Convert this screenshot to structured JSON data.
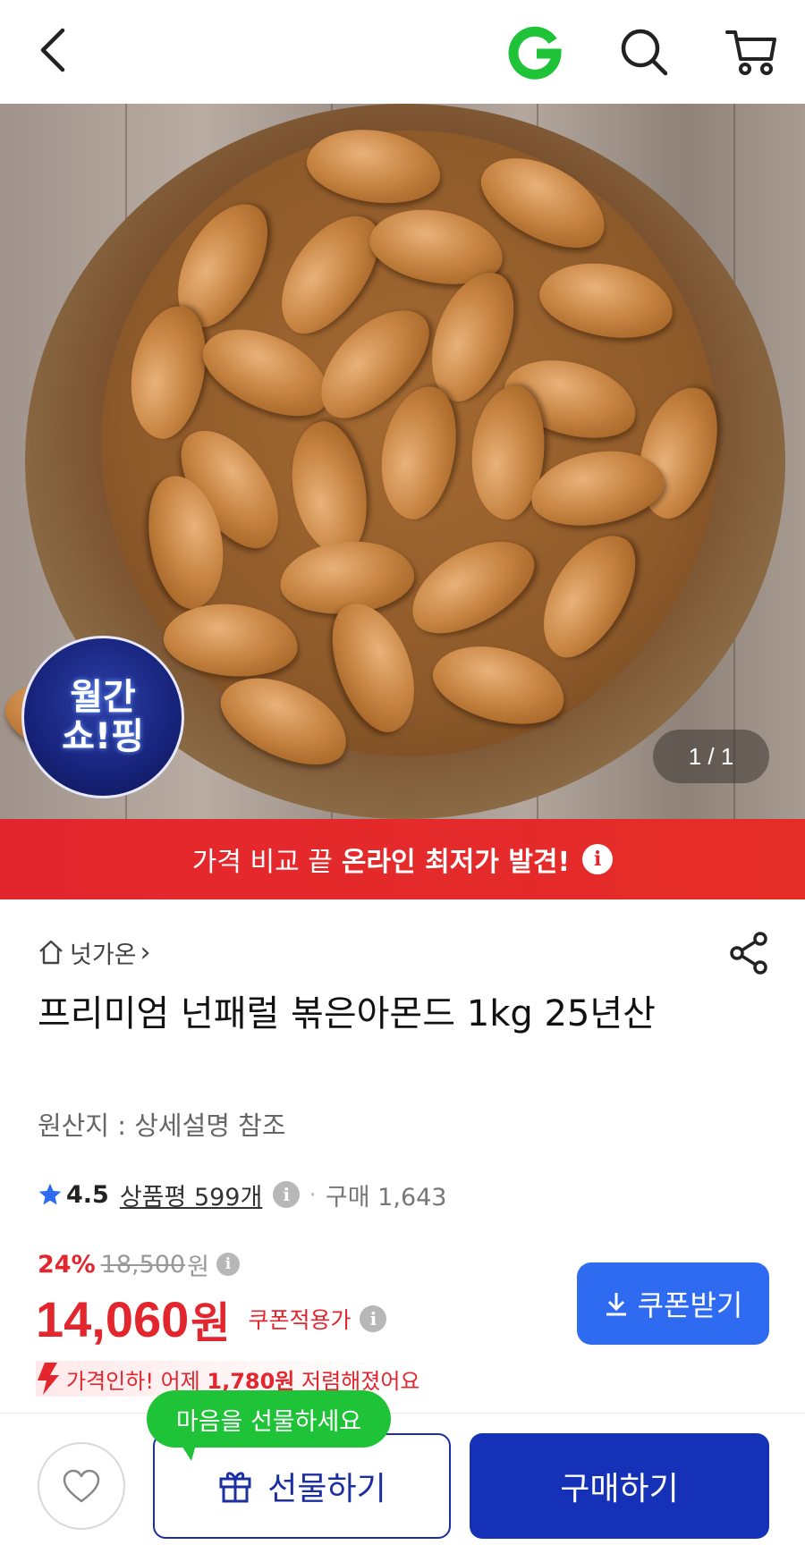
{
  "header": {
    "back_icon": "chevron-left-icon",
    "logo_icon": "gmarket-g-logo",
    "search_icon": "search-icon",
    "cart_icon": "cart-icon",
    "logo_color": "#1ec337"
  },
  "hero": {
    "badge_line1": "월간",
    "badge_line2": "쇼!핑",
    "counter": "1 / 1"
  },
  "banner": {
    "prefix": "가격 비교 끝",
    "highlight": "온라인 최저가 발견!",
    "info": "i",
    "color": "#e3262e"
  },
  "product": {
    "store": "넛가온",
    "store_chevron": "›",
    "title": "프리미엄 넌패럴 볶은아몬드 1kg 25년산",
    "origin": "원산지 : 상세설명 참조",
    "rating": "4.5",
    "reviews": "상품평 599개",
    "sold_sep": "·",
    "sold": "구매 1,643"
  },
  "price": {
    "discount": "24%",
    "original": "18,500",
    "original_unit": "원",
    "final": "14,060",
    "final_unit": "원",
    "coupon_note": "쿠폰적용가",
    "coupon_button": "쿠폰받기",
    "drop_prefix": "가격인하! 어제",
    "drop_amount": "1,780원",
    "drop_suffix": "저렴해졌어요"
  },
  "bottom": {
    "bubble": "마음을 선물하세요",
    "gift": "선물하기",
    "buy": "구매하기",
    "wish_icon": "heart-icon",
    "gift_icon": "gift-icon",
    "buy_color": "#1531b8"
  }
}
